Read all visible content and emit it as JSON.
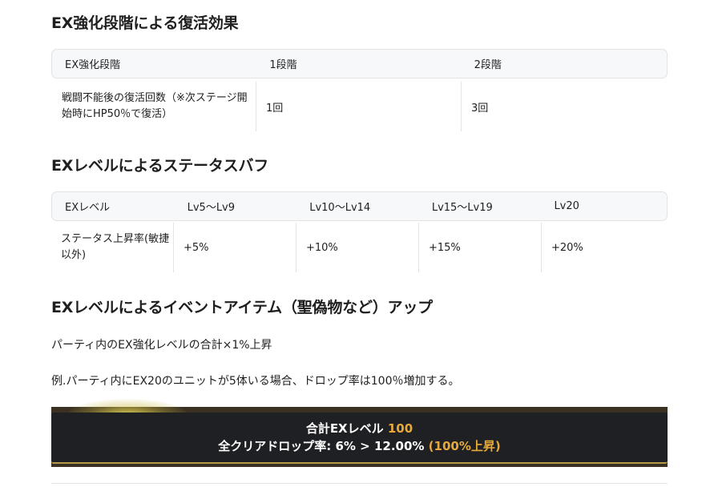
{
  "section1": {
    "heading": "EX強化段階による復活効果",
    "table": {
      "headers": [
        "EX強化段階",
        "1段階",
        "2段階"
      ],
      "row": [
        "戦闘不能後の復活回数（※次ステージ開始時にHP50％で復活）",
        "1回",
        "3回"
      ]
    }
  },
  "section2": {
    "heading": "EXレベルによるステータスバフ",
    "table": {
      "headers": [
        "EXレベル",
        "Lv5～Lv9",
        "Lv10～Lv14",
        "Lv15～Lv19",
        "Lv20"
      ],
      "row": [
        "ステータス上昇率(敏捷以外)",
        "+5%",
        "+10%",
        "+15%",
        "+20%"
      ]
    }
  },
  "section3": {
    "heading": "EXレベルによるイベントアイテム（聖偽物など）アップ",
    "paragraph1": "パーティ内のEX強化レベルの合計×1%上昇",
    "paragraph2": "例.パーティ内にEX20のユニットが5体いる場合、ドロップ率は100％増加する。"
  },
  "banner": {
    "line1_label": "合計EXレベル ",
    "line1_value": "100",
    "line2_label": "全クリアドロップ率: 6% > 12.00% ",
    "line2_value": "(100%上昇)",
    "accent_color": "#e8a93b",
    "background_color": "#1f2023"
  }
}
